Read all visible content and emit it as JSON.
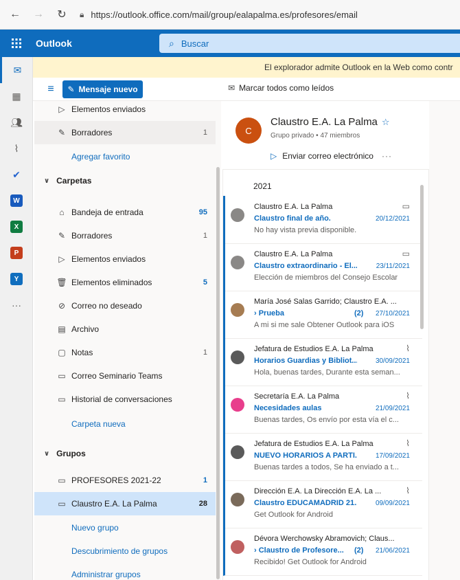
{
  "browser": {
    "url": "https://outlook.office.com/mail/group/ealapalma.es/profesores/email"
  },
  "suite": {
    "brand": "Outlook",
    "search_placeholder": "Buscar"
  },
  "banner": {
    "text": "El explorador admite Outlook en la Web como contr"
  },
  "toolbar": {
    "new_mail_label": "Mensaje nuevo",
    "mark_read_label": "Marcar todos como leídos"
  },
  "folders": {
    "top_items": [
      {
        "label": "Elementos enviados",
        "count": "",
        "icon": "send-icon"
      },
      {
        "label": "Borradores",
        "count": "1",
        "icon": "pencil-icon"
      }
    ],
    "add_favorite": "Agregar favorito",
    "section_folders": "Carpetas",
    "items": [
      {
        "label": "Bandeja de entrada",
        "count": "95",
        "icon": "inbox-icon"
      },
      {
        "label": "Borradores",
        "count": "1",
        "icon": "pencil-icon"
      },
      {
        "label": "Elementos enviados",
        "count": "",
        "icon": "send-icon"
      },
      {
        "label": "Elementos eliminados",
        "count": "5",
        "icon": "trash-icon"
      },
      {
        "label": "Correo no deseado",
        "count": "",
        "icon": "block-icon"
      },
      {
        "label": "Archivo",
        "count": "",
        "icon": "archive-icon"
      },
      {
        "label": "Notas",
        "count": "1",
        "icon": "note-icon"
      },
      {
        "label": "Correo Seminario Teams",
        "count": "",
        "icon": "folder-icon"
      },
      {
        "label": "Historial de conversaciones",
        "count": "",
        "icon": "folder-icon"
      }
    ],
    "new_folder": "Carpeta nueva",
    "section_groups": "Grupos",
    "groups": [
      {
        "label": "PROFESORES 2021-22",
        "count": "1"
      },
      {
        "label": "Claustro E.A. La Palma",
        "count": "28"
      }
    ],
    "new_group": "Nuevo grupo",
    "discover_groups": "Descubrimiento de grupos",
    "manage_groups": "Administrar grupos"
  },
  "group": {
    "initial": "C",
    "name": "Claustro E.A. La Palma",
    "privacy": "Grupo privado",
    "members": "47 miembros",
    "send_email": "Enviar correo electrónico",
    "more": "···"
  },
  "messages": {
    "year": "2021",
    "items": [
      {
        "from": "Claustro E.A. La Palma",
        "subject": "Claustro final de año.",
        "count": "",
        "date": "20/12/2021",
        "preview": "No hay vista previa disponible.",
        "icon": "calendar-icon",
        "color": "#8a8886"
      },
      {
        "from": "Claustro E.A. La Palma",
        "subject": "Claustro extraordinario - El...",
        "count": "",
        "date": "23/11/2021",
        "preview": "Elección de miembros del Consejo Escolar",
        "icon": "calendar-icon",
        "color": "#8a8886"
      },
      {
        "from": "María José Salas Garrido; Claustro E.A. ...",
        "subject": "› Prueba",
        "count": "(2)",
        "date": "27/10/2021",
        "preview": "A mi si me sale Obtener Outlook para iOS",
        "icon": "",
        "color": "#a67c52"
      },
      {
        "from": "Jefatura de Estudios E.A. La Palma",
        "subject": "Horarios Guardias y Bibliot...",
        "count": "",
        "date": "30/09/2021",
        "preview": "Hola, buenas tardes, Durante esta seman...",
        "icon": "paperclip-icon",
        "color": "#5a5a5a"
      },
      {
        "from": "Secretaría E.A. La Palma",
        "subject": "Necesidades aulas",
        "count": "",
        "date": "21/09/2021",
        "preview": "Buenas tardes, Os envío por esta vía el c...",
        "icon": "paperclip-icon",
        "color": "#e83e8c"
      },
      {
        "from": "Jefatura de Estudios E.A. La Palma",
        "subject": "NUEVO HORARIOS A PARTI...",
        "count": "",
        "date": "17/09/2021",
        "preview": "Buenas tardes a todos, Se ha enviado a t...",
        "icon": "paperclip-icon",
        "color": "#5a5a5a"
      },
      {
        "from": "Dirección E.A. La Dirección E.A. La ...",
        "subject": "Claustro EDUCAMADRID 21...",
        "count": "",
        "date": "09/09/2021",
        "preview": "Get Outlook for Android",
        "icon": "paperclip-icon",
        "color": "#7a6a5a"
      },
      {
        "from": "Dévora Werchowsky Abramovich; Claus...",
        "subject": "› Claustro de Profesore...",
        "count": "(2)",
        "date": "21/06/2021",
        "preview": "Recibido! Get Outlook for Android",
        "icon": "",
        "color": "#c06060"
      }
    ]
  },
  "rail_apps": [
    {
      "name": "mail-icon",
      "letter": "",
      "color": "#0f6cbd"
    },
    {
      "name": "calendar-icon",
      "letter": "",
      "color": "#605e5c"
    },
    {
      "name": "people-icon",
      "letter": "",
      "color": "#605e5c"
    },
    {
      "name": "attachment-icon",
      "letter": "",
      "color": "#605e5c"
    },
    {
      "name": "todo-icon",
      "letter": "",
      "color": "#2564cf"
    },
    {
      "name": "word-icon",
      "letter": "W",
      "color": "#185abd"
    },
    {
      "name": "excel-icon",
      "letter": "X",
      "color": "#107c41"
    },
    {
      "name": "powerpoint-icon",
      "letter": "P",
      "color": "#c43e1c"
    },
    {
      "name": "yammer-icon",
      "letter": "Y",
      "color": "#106ebe"
    },
    {
      "name": "more-apps-icon",
      "letter": "",
      "color": "#605e5c"
    }
  ]
}
